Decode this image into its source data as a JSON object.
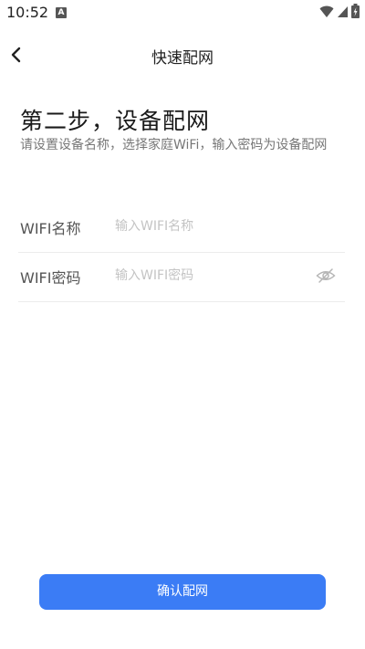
{
  "status_bar": {
    "time": "10:52",
    "notification_icon": "a-box-icon",
    "icons": [
      "wifi-icon",
      "signal-icon",
      "battery-charging-icon"
    ]
  },
  "header": {
    "title": "快速配网",
    "back_icon": "chevron-left-icon"
  },
  "step": {
    "title": "第二步，设备配网",
    "description": "请设置设备名称，选择家庭WiFi，输入密码为设备配网"
  },
  "form": {
    "wifi_name": {
      "label": "WIFI名称",
      "placeholder": "输入WIFI名称",
      "value": ""
    },
    "wifi_password": {
      "label": "WIFI密码",
      "placeholder": "输入WIFI密码",
      "value": "",
      "toggle_icon": "eye-hidden-icon"
    }
  },
  "confirm_button": {
    "label": "确认配网",
    "color": "#3b7cf5"
  }
}
